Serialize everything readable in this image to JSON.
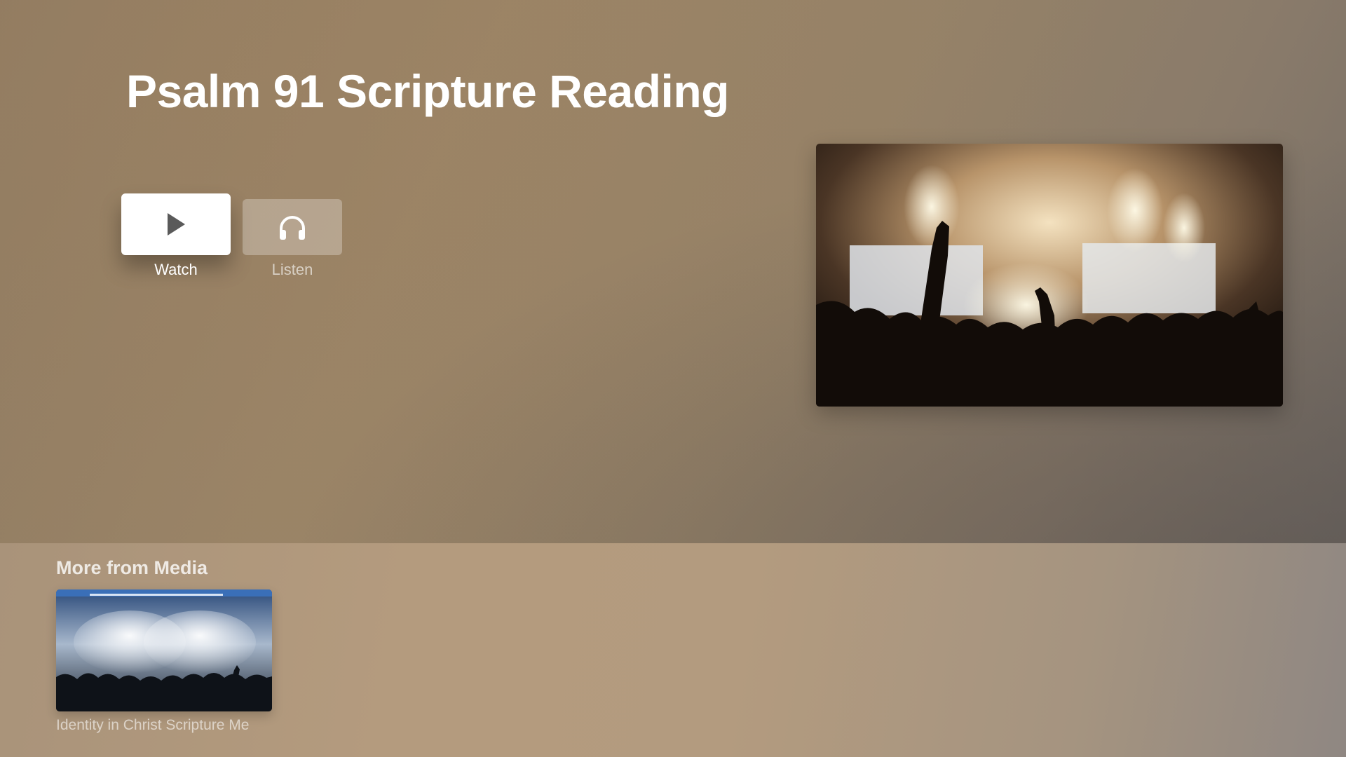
{
  "page": {
    "title": "Psalm 91 Scripture Reading"
  },
  "actions": {
    "watch_label": "Watch",
    "listen_label": "Listen"
  },
  "feature_image": {
    "description": "concert-crowd-with-raised-hands"
  },
  "shelf": {
    "title": "More from Media",
    "items": [
      {
        "caption": "Identity in Christ Scripture Me"
      }
    ]
  },
  "icons": {
    "watch": "play-icon",
    "listen": "headphones-icon"
  },
  "colors": {
    "background": "#958268",
    "shelf_background": "#b39b7f",
    "focused_button": "#ffffff"
  }
}
